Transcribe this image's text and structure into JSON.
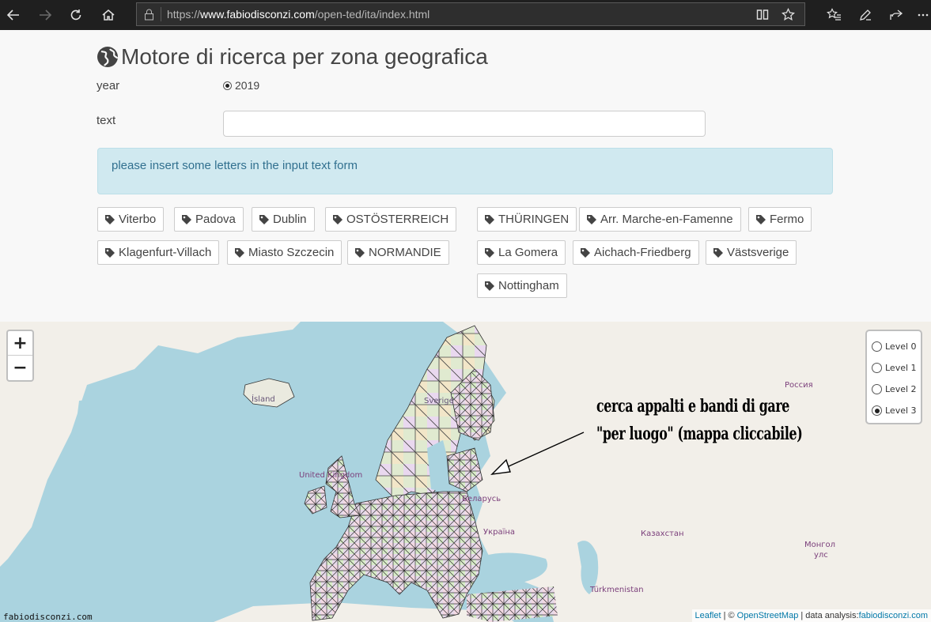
{
  "browser": {
    "url_prefix": "https://",
    "url_host": "www.fabiodisconzi.com",
    "url_path": "/open-ted/ita/index.html"
  },
  "page": {
    "title": "Motore di ricerca per zona geografica",
    "year_label": "year",
    "year_option": "2019",
    "text_label": "text",
    "text_value": "",
    "alert": "please insert some letters in the input text form"
  },
  "tags_left": [
    "Viterbo",
    "Padova",
    "Dublin",
    "OSTÖSTERREICH",
    "Klagenfurt-Villach",
    "Miasto Szczecin",
    "NORMANDIE"
  ],
  "tags_right": [
    "THÜRINGEN",
    "Arr. Marche-en-Famenne",
    "Fermo",
    "La Gomera",
    "Aichach-Friedberg",
    "Västsverige",
    "Nottingham"
  ],
  "map": {
    "levels": [
      "Level 0",
      "Level 1",
      "Level 2",
      "Level 3"
    ],
    "selected_level": "Level 3",
    "zoom_in": "+",
    "zoom_out": "−",
    "annotation_line1": "cerca appalti e bandi di gare",
    "annotation_line2": "\"per luogo\" (mappa cliccabile)",
    "labels": {
      "island": "Ísland",
      "sverige": "Sverige",
      "uk": "United Kingdom",
      "russia": "Россия",
      "belarus": "Беларусь",
      "ukraine": "Україна",
      "kazakhstan": "Казахстан",
      "mongolia1": "Монгол",
      "mongolia2": "улс",
      "turkmenistan": "Türkmenistan"
    },
    "attribution": {
      "leaflet": "Leaflet",
      "sep1": " | © ",
      "osm": "OpenStreetMap",
      "sep2": " | data analysis:",
      "site": "fabiodisconzi.com"
    },
    "watermark": "fabiodisconzi.com"
  },
  "colors": {
    "chrome": "#1f1f1f",
    "sea": "#aad3df",
    "land": "#f2efe9",
    "alert_bg": "#d0e9f0",
    "alert_text": "#31708f",
    "link": "#0078a8"
  }
}
